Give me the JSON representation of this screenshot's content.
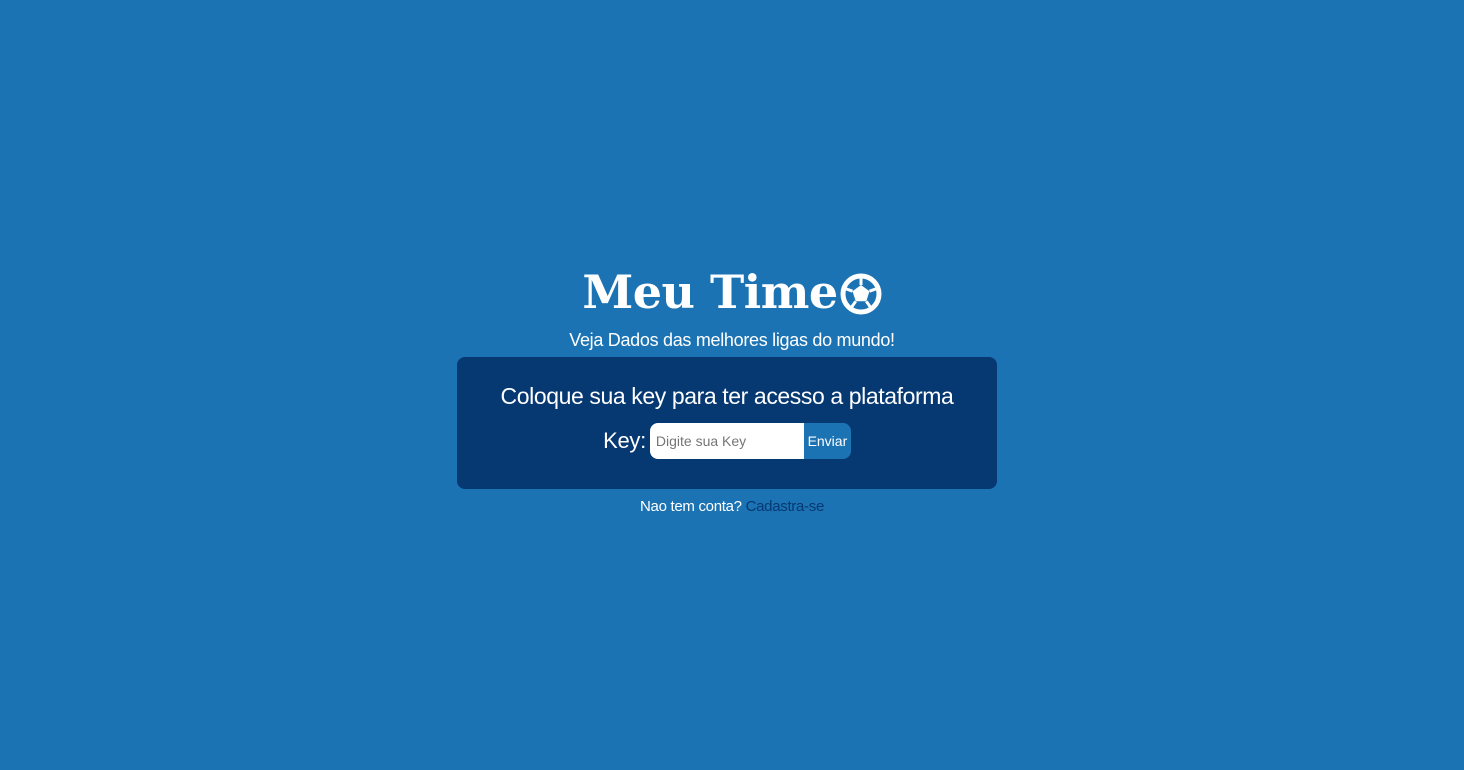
{
  "brand": {
    "title": "Meu Time",
    "icon": "soccer-ball-icon",
    "subtitle": "Veja Dados das melhores ligas do mundo!"
  },
  "login_card": {
    "heading": "Coloque sua key para ter acesso a plataforma",
    "key_label": "Key:",
    "key_input": {
      "placeholder": "Digite sua Key",
      "value": ""
    },
    "submit_label": "Enviar"
  },
  "signup": {
    "prompt": "Nao tem conta?",
    "link_label": "Cadastra-se"
  },
  "colors": {
    "background": "#1b73b3",
    "card": "#063872",
    "text": "#ffffff",
    "link": "#063872"
  }
}
